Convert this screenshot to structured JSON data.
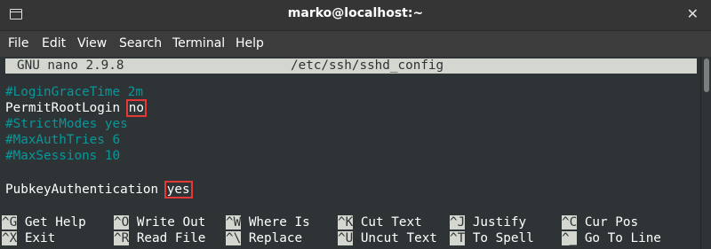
{
  "window": {
    "title": "marko@localhost:~",
    "close_glyph": "✕"
  },
  "menu": [
    "File",
    "Edit",
    "View",
    "Search",
    "Terminal",
    "Help"
  ],
  "nano": {
    "version": "GNU nano 2.9.8",
    "filename": "/etc/ssh/sshd_config"
  },
  "lines": {
    "l1": "#LoginGraceTime 2m",
    "l2_key": "PermitRootLogin ",
    "l2_val": "no",
    "l3": "#StrictModes yes",
    "l4": "#MaxAuthTries 6",
    "l5": "#MaxSessions 10",
    "l6_key": "PubkeyAuthentication ",
    "l6_val": "yes"
  },
  "shortcuts": {
    "row1": [
      {
        "key": "^G",
        "label": "Get Help"
      },
      {
        "key": "^O",
        "label": "Write Out"
      },
      {
        "key": "^W",
        "label": "Where Is"
      },
      {
        "key": "^K",
        "label": "Cut Text"
      },
      {
        "key": "^J",
        "label": "Justify"
      },
      {
        "key": "^C",
        "label": "Cur Pos"
      }
    ],
    "row2": [
      {
        "key": "^X",
        "label": "Exit"
      },
      {
        "key": "^R",
        "label": "Read File"
      },
      {
        "key": "^\\",
        "label": "Replace"
      },
      {
        "key": "^U",
        "label": "Uncut Text"
      },
      {
        "key": "^T",
        "label": "To Spell"
      },
      {
        "key": "^_",
        "label": "Go To Line"
      }
    ]
  },
  "colors": {
    "terminal_bg": "#2e3436",
    "comment": "#06989a",
    "highlight_box": "#e53935"
  }
}
